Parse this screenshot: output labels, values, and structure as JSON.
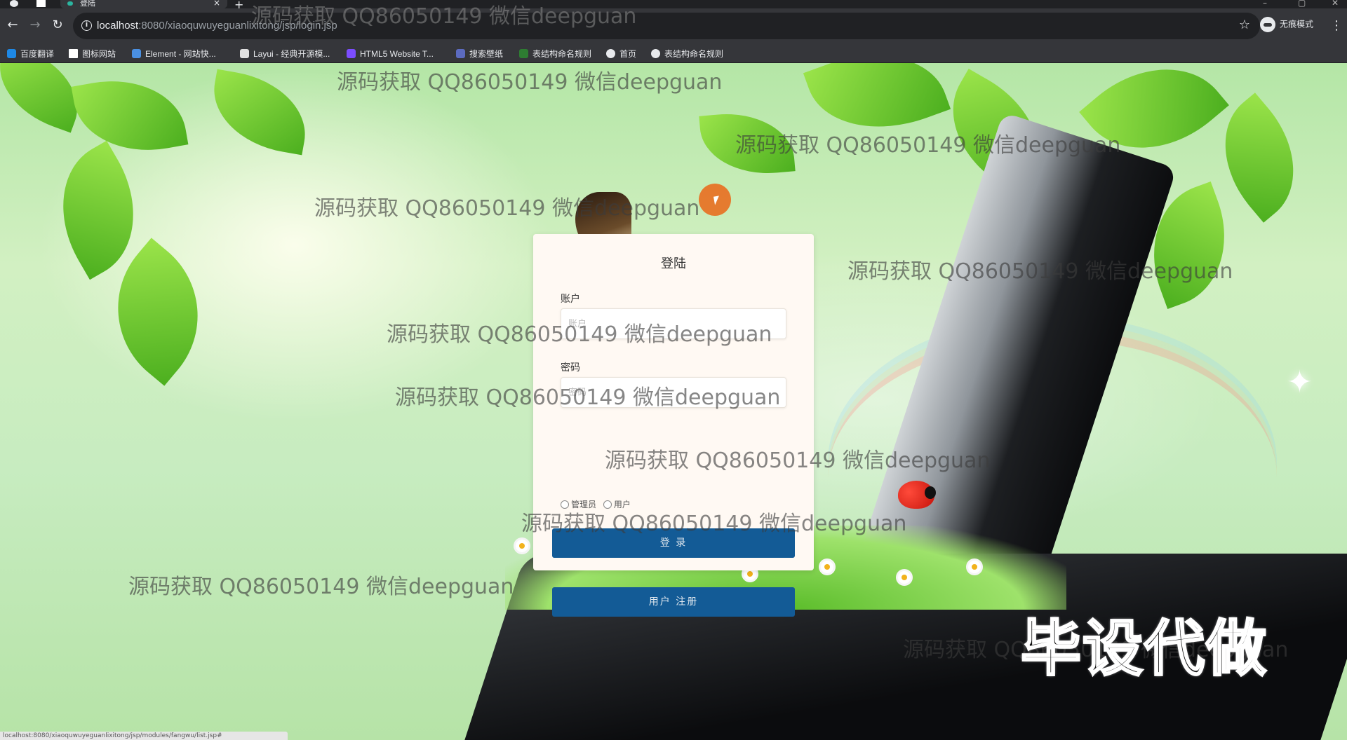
{
  "browser": {
    "tab_title": "登陆",
    "tab_close": "×",
    "new_tab": "+",
    "url_host": "localhost",
    "url_rest": ":8080/xiaoquwuyeguanlixitong/jsp/login.jsp",
    "incognito_label": "无痕模式",
    "bookmarks": [
      "百度翻译",
      "图标网站",
      "Element - 网站快...",
      "Layui - 经典开源模...",
      "HTML5 Website T...",
      "搜索壁纸",
      "表结构命名规则",
      "首页",
      "表结构命名规则"
    ],
    "bookmark_colors": [
      "#1e88e5",
      "#ffffff",
      "#4a90e2",
      "#e0e0e0",
      "#7c4dff",
      "#5c6bc0",
      "#2e7d32",
      "#e8eaed",
      "#e8eaed"
    ]
  },
  "login": {
    "title": "登陆",
    "account_label": "账户",
    "account_placeholder": "账户",
    "password_label": "密码",
    "password_placeholder": "密码",
    "role_admin": "管理员",
    "role_user": "用户",
    "login_button": "登 录",
    "register_button": "用户 注册"
  },
  "watermarks": {
    "text": "源码获取 QQ86050149 微信deepguan",
    "stamp": "毕设代做"
  },
  "statusbar": {
    "url": "localhost:8080/xiaoquwuyeguanlixitong/jsp/modules/fangwu/list.jsp#"
  },
  "colors": {
    "button": "#135b96",
    "card": "#fff9f3"
  }
}
